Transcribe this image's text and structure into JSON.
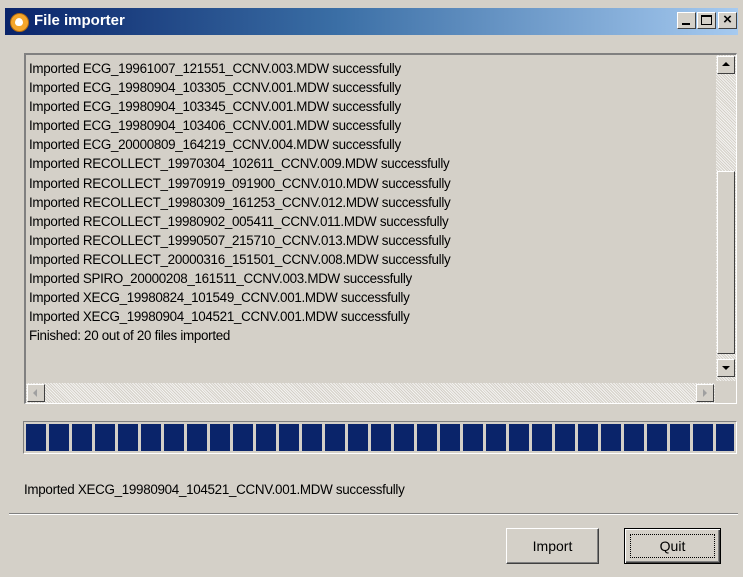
{
  "window": {
    "title": "File importer",
    "icon": "app-logo-icon",
    "title_bar_colors": [
      "#0a246a",
      "#a6caf0"
    ]
  },
  "log": {
    "lines": [
      "Imported ECG_19961007_121551_CCNV.003.MDW successfully",
      "Imported ECG_19980904_103305_CCNV.001.MDW successfully",
      "Imported ECG_19980904_103345_CCNV.001.MDW successfully",
      "Imported ECG_19980904_103406_CCNV.001.MDW successfully",
      "Imported ECG_20000809_164219_CCNV.004.MDW successfully",
      "Imported RECOLLECT_19970304_102611_CCNV.009.MDW successfully",
      "Imported RECOLLECT_19970919_091900_CCNV.010.MDW successfully",
      "Imported RECOLLECT_19980309_161253_CCNV.012.MDW successfully",
      "Imported RECOLLECT_19980902_005411_CCNV.011.MDW successfully",
      "Imported RECOLLECT_19990507_215710_CCNV.013.MDW successfully",
      "Imported RECOLLECT_20000316_151501_CCNV.008.MDW successfully",
      "Imported SPIRO_20000208_161511_CCNV.003.MDW successfully",
      "Imported XECG_19980824_101549_CCNV.001.MDW successfully",
      "Imported XECG_19980904_104521_CCNV.001.MDW successfully",
      "Finished: 20 out of 20 files imported"
    ]
  },
  "progress": {
    "fraction": 1.0,
    "fill_color": "#0a246a"
  },
  "status": {
    "text": "Imported XECG_19980904_104521_CCNV.001.MDW successfully"
  },
  "buttons": {
    "import_label": "Import",
    "quit_label": "Quit"
  }
}
